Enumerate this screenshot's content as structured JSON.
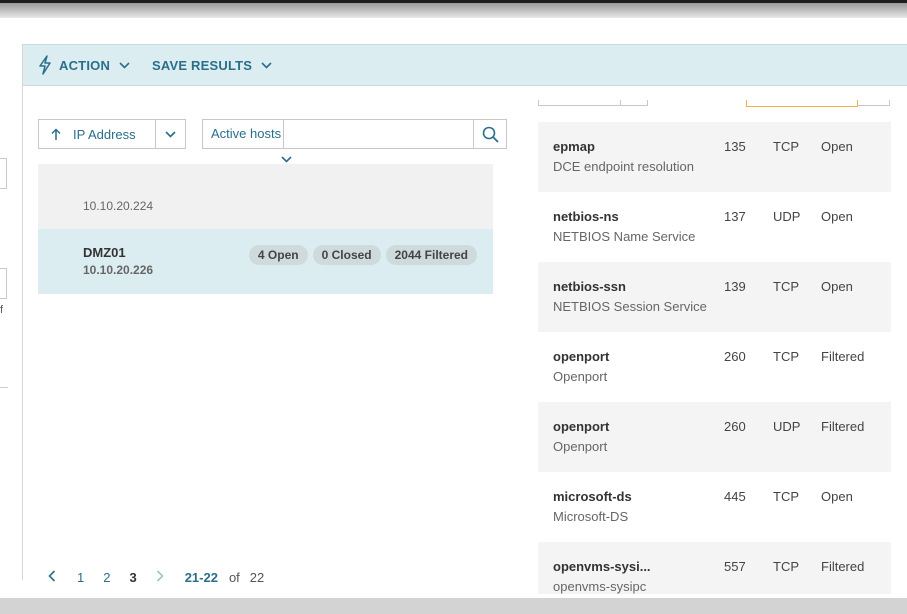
{
  "toolbar": {
    "action_label": "ACTION",
    "save_results_label": "SAVE RESULTS"
  },
  "left_panel": {
    "partial_text": "f"
  },
  "hosts": {
    "sort": {
      "label": "IP Address",
      "direction": "ascending"
    },
    "filter": {
      "label": "Active hosts",
      "value": ""
    },
    "rows": [
      {
        "name": "",
        "ip": "10.10.20.224"
      },
      {
        "name": "DMZ01",
        "ip": "10.10.20.226",
        "badges": [
          "4 Open",
          "0 Closed",
          "2044 Filtered"
        ]
      }
    ]
  },
  "pagination": {
    "pages": [
      "1",
      "2",
      "3"
    ],
    "current_page": "3",
    "range": "21-22",
    "of_label": "of",
    "total": "22"
  },
  "ports": [
    {
      "service": "epmap",
      "description": "DCE endpoint resolution",
      "port": "135",
      "protocol": "TCP",
      "state": "Open"
    },
    {
      "service": "netbios-ns",
      "description": "NETBIOS Name Service",
      "port": "137",
      "protocol": "UDP",
      "state": "Open"
    },
    {
      "service": "netbios-ssn",
      "description": "NETBIOS Session Service",
      "port": "139",
      "protocol": "TCP",
      "state": "Open"
    },
    {
      "service": "openport",
      "description": "Openport",
      "port": "260",
      "protocol": "TCP",
      "state": "Filtered"
    },
    {
      "service": "openport",
      "description": "Openport",
      "port": "260",
      "protocol": "UDP",
      "state": "Filtered"
    },
    {
      "service": "microsoft-ds",
      "description": "Microsoft-DS",
      "port": "445",
      "protocol": "TCP",
      "state": "Open"
    },
    {
      "service": "openvms-sysi...",
      "description": "openvms-sysipc",
      "port": "557",
      "protocol": "TCP",
      "state": "Filtered"
    }
  ],
  "colors": {
    "accent": "#2a6f8a",
    "selected_row": "#dcedf1",
    "toolbar_bg": "#dcedf1",
    "active_tab_border": "#f0b24a"
  },
  "icons": {
    "action": "lightning-icon",
    "dropdown": "chevron-down-icon",
    "sort": "arrow-up-icon",
    "search": "search-icon",
    "prev": "chevron-left-icon",
    "next": "chevron-right-icon"
  }
}
